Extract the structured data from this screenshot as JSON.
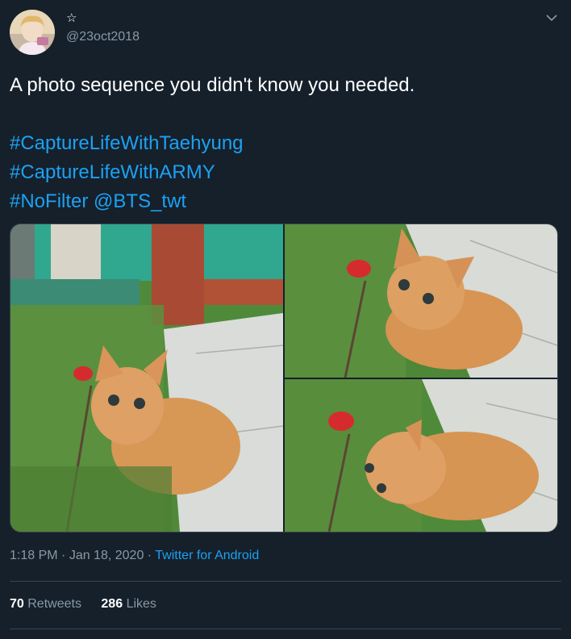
{
  "author": {
    "star": "☆",
    "handle": "@23oct2018"
  },
  "tweet": {
    "text": "A photo sequence you didn't know you needed.",
    "hashtag1": "#CaptureLifeWithTaehyung",
    "hashtag2": "#CaptureLifeWithARMY",
    "hashtag3": "#NoFilter",
    "mention": "@BTS_twt"
  },
  "meta": {
    "time": "1:18 PM",
    "separator1": " · ",
    "date": "Jan 18, 2020",
    "separator2": " · ",
    "source": "Twitter for Android"
  },
  "stats": {
    "retweets_count": "70",
    "retweets_label": "Retweets",
    "likes_count": "286",
    "likes_label": "Likes"
  },
  "colors": {
    "background": "#15202b",
    "link": "#1da1f2",
    "secondary_text": "#8899a6",
    "divider": "#38444d"
  },
  "icons": {
    "caret": "chevron-down-icon",
    "avatar": "avatar"
  }
}
